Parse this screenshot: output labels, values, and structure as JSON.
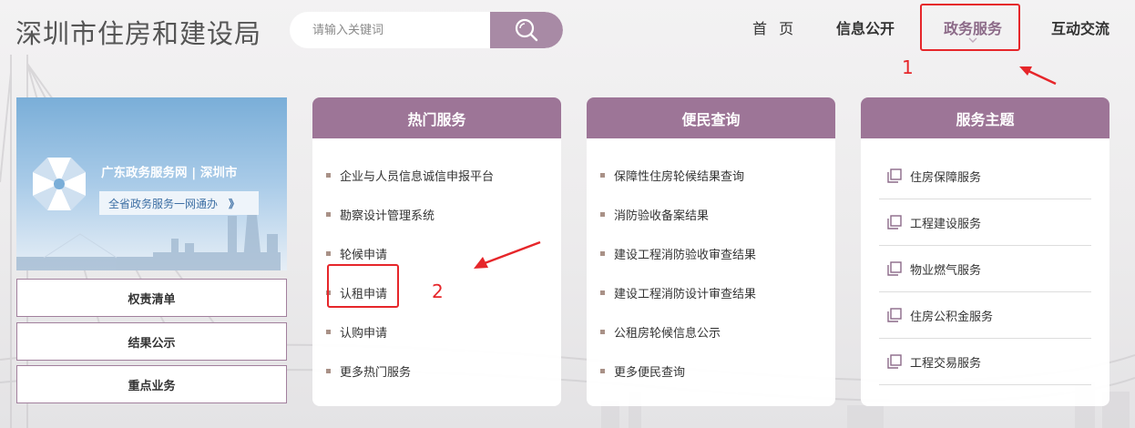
{
  "header": {
    "site_title": "深圳市住房和建设局",
    "search_placeholder": "请输入关键词"
  },
  "nav": {
    "items": [
      {
        "label": "首 页"
      },
      {
        "label": "信息公开"
      },
      {
        "label": "政务服务"
      },
      {
        "label": "互动交流"
      }
    ],
    "active": "政务服务"
  },
  "annotations": {
    "marker_1": "1",
    "marker_2": "2"
  },
  "banner": {
    "title": "广东政务服务网 | 深圳市",
    "subtitle": "全省政务服务一网通办",
    "chevron": "》"
  },
  "side_buttons": [
    "权责清单",
    "结果公示",
    "重点业务"
  ],
  "panels": {
    "hot_services": {
      "title": "热门服务",
      "items": [
        "企业与人员信息诚信申报平台",
        "勘察设计管理系统",
        "轮候申请",
        "认租申请",
        "认购申请",
        "更多热门服务"
      ]
    },
    "public_query": {
      "title": "便民查询",
      "items": [
        "保障性住房轮候结果查询",
        "消防验收备案结果",
        "建设工程消防验收审查结果",
        "建设工程消防设计审查结果",
        "公租房轮候信息公示",
        "更多便民查询"
      ]
    },
    "service_topics": {
      "title": "服务主题",
      "items": [
        "住房保障服务",
        "工程建设服务",
        "物业燃气服务",
        "住房公积金服务",
        "工程交易服务"
      ]
    }
  },
  "colors": {
    "accent": "#9d7597",
    "search_button": "#a88aa5",
    "highlight": "#e6262a",
    "bullet": "#a99187"
  },
  "icons": {
    "search": "search-icon",
    "caret": "chevron-down-icon",
    "topic": "copy-icon",
    "banner_logo": "pinwheel-logo-icon"
  }
}
